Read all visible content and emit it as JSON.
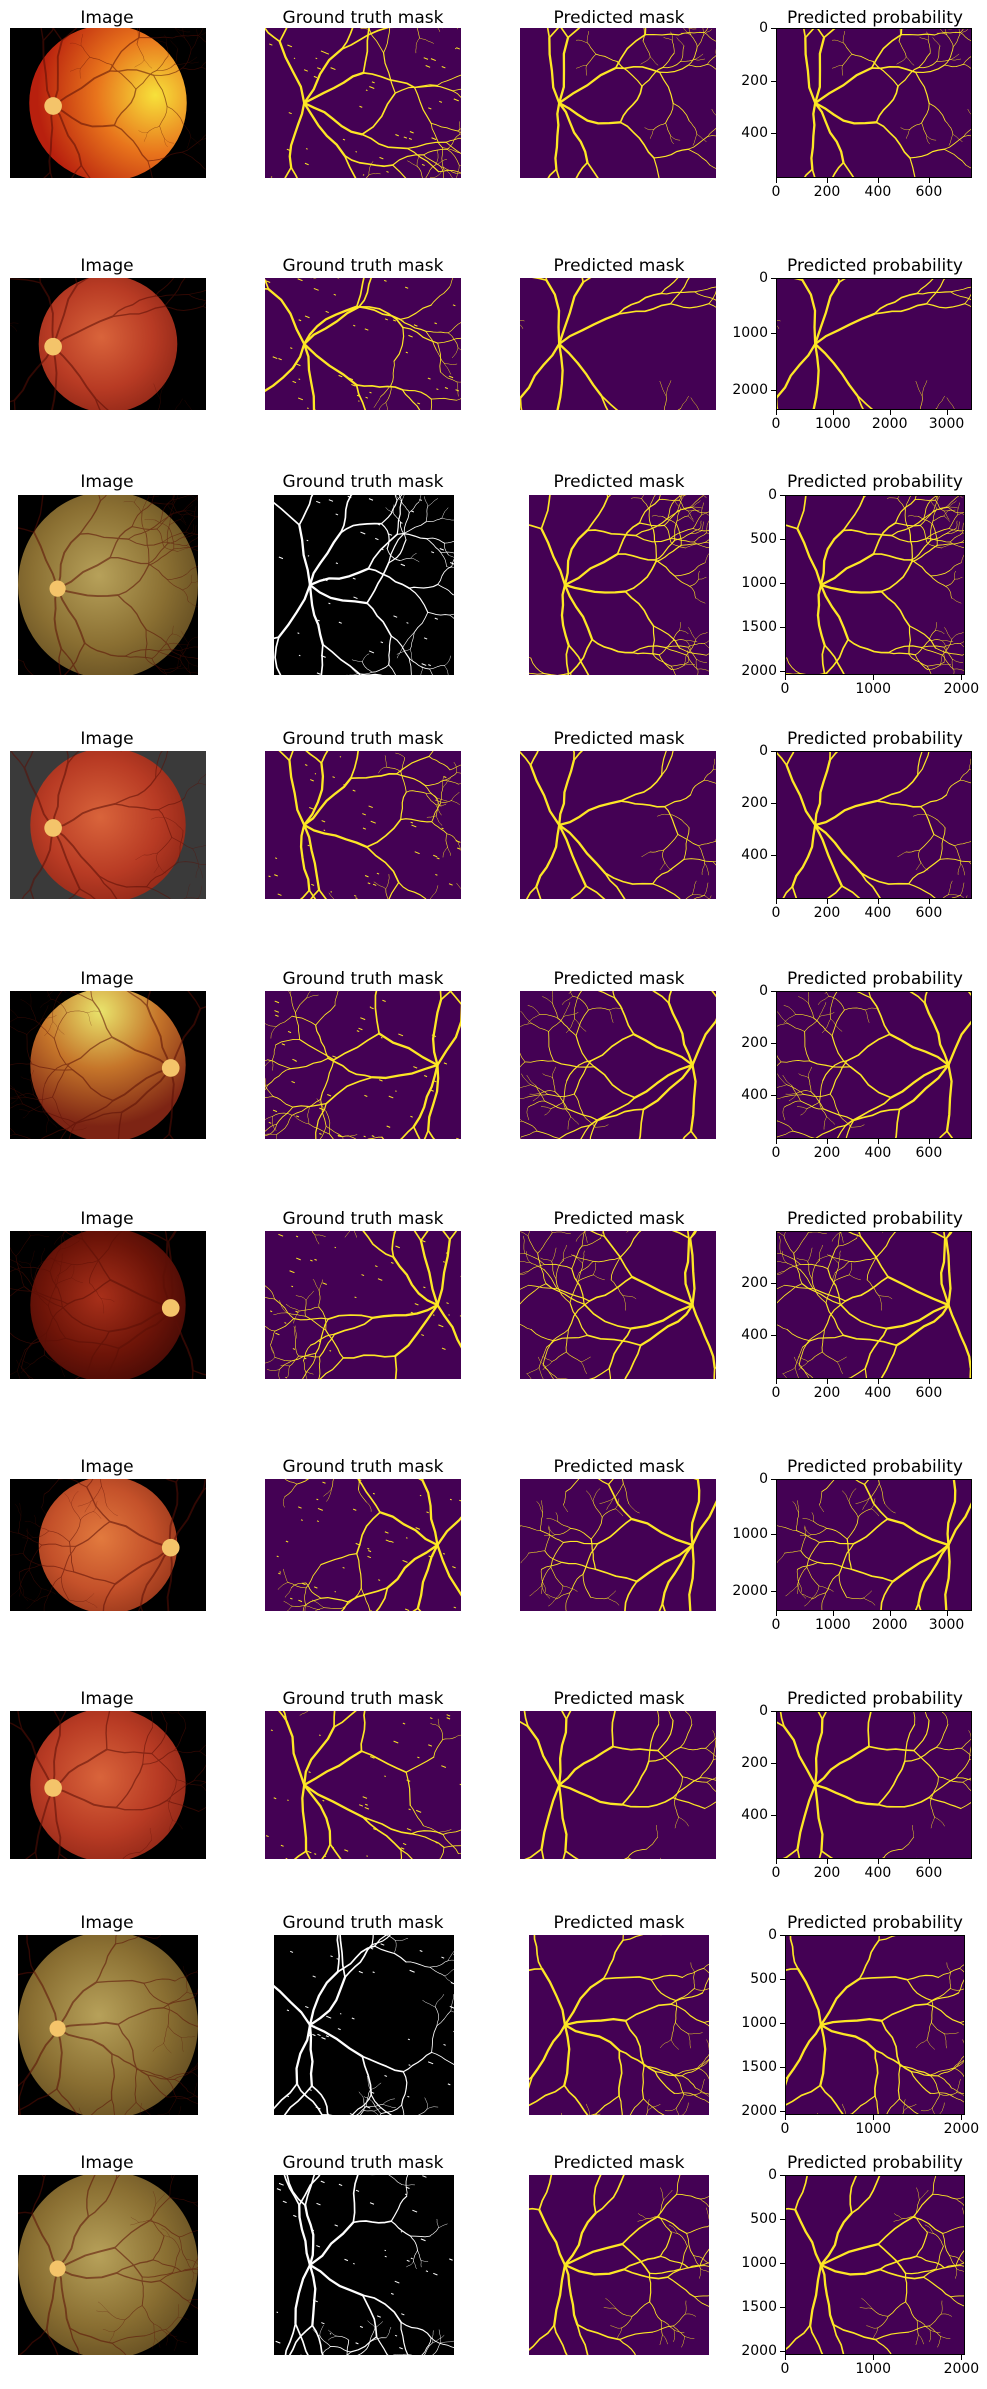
{
  "column_titles": {
    "image": "Image",
    "ground_truth": "Ground truth mask",
    "predicted_mask": "Predicted mask",
    "predicted_probability": "Predicted probability"
  },
  "colors": {
    "mask_background": "#440154",
    "mask_vessel": "#fde725",
    "binary_background": "#000000",
    "binary_vessel": "#ffffff",
    "fundus_red": "#c8431c",
    "fundus_orange": "#e46a21",
    "fundus_olive": "#8a7a3c"
  },
  "rows": [
    {
      "fundus": "bright-orange",
      "gt_style": "viridis",
      "y_ticks": [
        "0",
        "200",
        "400"
      ],
      "x_ticks": [
        "0",
        "200",
        "400",
        "600"
      ]
    },
    {
      "fundus": "red",
      "gt_style": "viridis",
      "y_ticks": [
        "0",
        "1000",
        "2000"
      ],
      "x_ticks": [
        "0",
        "1000",
        "2000",
        "3000"
      ]
    },
    {
      "fundus": "olive",
      "gt_style": "binary",
      "y_ticks": [
        "0",
        "500",
        "1000",
        "1500",
        "2000"
      ],
      "x_ticks": [
        "0",
        "1000",
        "2000"
      ]
    },
    {
      "fundus": "red",
      "gt_style": "viridis",
      "y_ticks": [
        "0",
        "200",
        "400"
      ],
      "x_ticks": [
        "0",
        "200",
        "400",
        "600"
      ]
    },
    {
      "fundus": "yellow-green",
      "gt_style": "viridis",
      "y_ticks": [
        "0",
        "200",
        "400"
      ],
      "x_ticks": [
        "0",
        "200",
        "400",
        "600"
      ]
    },
    {
      "fundus": "dark-red",
      "gt_style": "viridis",
      "y_ticks": [
        "200",
        "400"
      ],
      "x_ticks": [
        "0",
        "200",
        "400",
        "600"
      ]
    },
    {
      "fundus": "orange",
      "gt_style": "viridis",
      "y_ticks": [
        "0",
        "1000",
        "2000"
      ],
      "x_ticks": [
        "0",
        "1000",
        "2000",
        "3000"
      ]
    },
    {
      "fundus": "red",
      "gt_style": "viridis",
      "y_ticks": [
        "0",
        "200",
        "400"
      ],
      "x_ticks": [
        "0",
        "200",
        "400",
        "600"
      ]
    },
    {
      "fundus": "olive",
      "gt_style": "binary",
      "y_ticks": [
        "0",
        "500",
        "1000",
        "1500",
        "2000"
      ],
      "x_ticks": [
        "0",
        "1000",
        "2000"
      ]
    },
    {
      "fundus": "olive",
      "gt_style": "binary",
      "y_ticks": [
        "0",
        "500",
        "1000",
        "1500",
        "2000"
      ],
      "x_ticks": [
        "0",
        "1000",
        "2000"
      ]
    }
  ]
}
